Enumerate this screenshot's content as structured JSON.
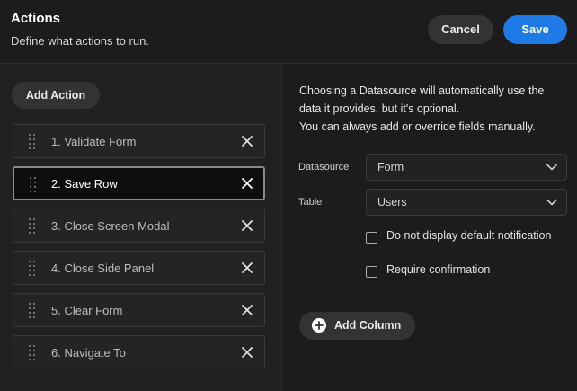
{
  "header": {
    "title": "Actions",
    "subtitle": "Define what actions to run.",
    "cancel_label": "Cancel",
    "save_label": "Save"
  },
  "actions_panel": {
    "add_action_label": "Add Action",
    "selected_index": 1,
    "items": [
      {
        "label": "1. Validate Form"
      },
      {
        "label": "2. Save Row"
      },
      {
        "label": "3. Close Screen Modal"
      },
      {
        "label": "4. Close Side Panel"
      },
      {
        "label": "5. Clear Form"
      },
      {
        "label": "6. Navigate To"
      }
    ]
  },
  "settings": {
    "info_lines": [
      "Choosing a Datasource will automatically use the",
      "data it provides, but it's optional.",
      "You can always add or override fields manually."
    ],
    "datasource": {
      "label": "Datasource",
      "value": "Form"
    },
    "table": {
      "label": "Table",
      "value": "Users"
    },
    "checkboxes": [
      {
        "label": "Do not display default notification",
        "checked": false
      },
      {
        "label": "Require confirmation",
        "checked": false
      }
    ],
    "add_column_label": "Add Column"
  },
  "icons": {
    "drag": "drag-handle-icon",
    "remove": "close-icon",
    "chevron": "chevron-down-icon",
    "plus": "plus-circle-icon"
  },
  "colors": {
    "accent": "#1f7ae6",
    "background": "#1c1c1c",
    "panel": "#212121"
  }
}
